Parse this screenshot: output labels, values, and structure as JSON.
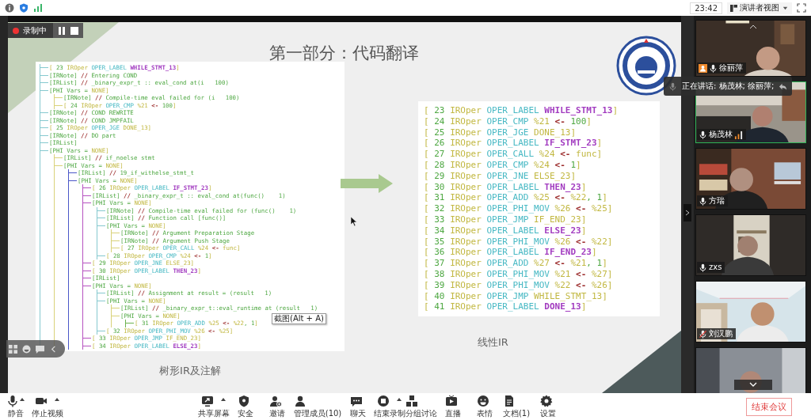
{
  "top_bar": {
    "time": "23:42",
    "view_button": {
      "label": "演讲者视图"
    }
  },
  "recording": {
    "label": "录制中"
  },
  "slide": {
    "title": "第一部分：代码翻译",
    "tree_panel": {
      "caption": "树形IR及注解",
      "lines": [
        {
          "tokens": [
            {
              "kind": "type",
              "text": "[ "
            },
            {
              "kind": "text",
              "text": "23 "
            },
            {
              "kind": "type",
              "text": "IROper "
            },
            {
              "kind": "opcode",
              "text": "OPER_LABEL "
            },
            {
              "kind": "label",
              "text": "WHILE_STMT_13"
            },
            {
              "kind": "type",
              "text": "]"
            }
          ]
        },
        {
          "tokens": [
            {
              "kind": "text",
              "text": "[IRNote] "
            },
            {
              "kind": "symbol",
              "text": "//"
            },
            {
              "kind": "text",
              "text": " Entering COND"
            }
          ]
        },
        {
          "tokens": [
            {
              "kind": "text",
              "text": "[IRList] "
            },
            {
              "kind": "symbol",
              "text": "//"
            },
            {
              "kind": "text",
              "text": " _binary_expr_t :: eval_cond at(i   100)"
            }
          ]
        },
        {
          "tokens": [
            {
              "kind": "text",
              "text": "[PHI Vars = "
            },
            {
              "kind": "type",
              "text": "NONE]"
            }
          ],
          "children": [
            {
              "tokens": [
                {
                  "kind": "text",
                  "text": "[IRNote] "
                },
                {
                  "kind": "symbol",
                  "text": "//"
                },
                {
                  "kind": "text",
                  "text": " Compile-time eval failed for (i   100)"
                }
              ]
            },
            {
              "tokens": [
                {
                  "kind": "type",
                  "text": "[ "
                },
                {
                  "kind": "text",
                  "text": "24 "
                },
                {
                  "kind": "type",
                  "text": "IROper "
                },
                {
                  "kind": "opcode",
                  "text": "OPER_CMP "
                },
                {
                  "kind": "type",
                  "text": "%21 "
                },
                {
                  "kind": "symbol",
                  "text": "<-"
                },
                {
                  "kind": "text",
                  "text": " 100"
                },
                {
                  "kind": "type",
                  "text": "]"
                }
              ]
            }
          ]
        },
        {
          "tokens": [
            {
              "kind": "text",
              "text": "[IRNote] "
            },
            {
              "kind": "symbol",
              "text": "//"
            },
            {
              "kind": "text",
              "text": " COND REWRITE"
            }
          ]
        },
        {
          "tokens": [
            {
              "kind": "text",
              "text": "[IRNote] "
            },
            {
              "kind": "symbol",
              "text": "//"
            },
            {
              "kind": "text",
              "text": " COND JMPFAIL"
            }
          ]
        },
        {
          "tokens": [
            {
              "kind": "type",
              "text": "[ "
            },
            {
              "kind": "text",
              "text": "25 "
            },
            {
              "kind": "type",
              "text": "IROper "
            },
            {
              "kind": "opcode",
              "text": "OPER_JGE "
            },
            {
              "kind": "type",
              "text": "DONE_13]"
            }
          ]
        },
        {
          "tokens": [
            {
              "kind": "text",
              "text": "[IRNote] "
            },
            {
              "kind": "symbol",
              "text": "//"
            },
            {
              "kind": "text",
              "text": " DO part"
            }
          ]
        },
        {
          "tokens": [
            {
              "kind": "text",
              "text": "[IRList]"
            }
          ]
        },
        {
          "tokens": [
            {
              "kind": "text",
              "text": "[PHI Vars = "
            },
            {
              "kind": "type",
              "text": "NONE]"
            }
          ],
          "children": [
            {
              "tokens": [
                {
                  "kind": "text",
                  "text": "[IRList] "
                },
                {
                  "kind": "symbol",
                  "text": "//"
                },
                {
                  "kind": "text",
                  "text": " if_noelse stmt"
                }
              ]
            },
            {
              "tokens": [
                {
                  "kind": "text",
                  "text": "[PHI Vars = "
                },
                {
                  "kind": "type",
                  "text": "NONE]"
                }
              ],
              "children": [
                {
                  "tokens": [
                    {
                      "kind": "text",
                      "text": "[IRList] "
                    },
                    {
                      "kind": "symbol",
                      "text": "//"
                    },
                    {
                      "kind": "text",
                      "text": " 19_if_withelse_stmt_t"
                    }
                  ]
                },
                {
                  "tokens": [
                    {
                      "kind": "text",
                      "text": "[PHI Vars = "
                    },
                    {
                      "kind": "type",
                      "text": "NONE]"
                    }
                  ],
                  "children": [
                    {
                      "tokens": [
                        {
                          "kind": "type",
                          "text": "[ "
                        },
                        {
                          "kind": "text",
                          "text": "26 "
                        },
                        {
                          "kind": "type",
                          "text": "IROper "
                        },
                        {
                          "kind": "opcode",
                          "text": "OPER_LABEL "
                        },
                        {
                          "kind": "label",
                          "text": "IF_STMT_23"
                        },
                        {
                          "kind": "type",
                          "text": "]"
                        }
                      ]
                    },
                    {
                      "tokens": [
                        {
                          "kind": "text",
                          "text": "[IRList] "
                        },
                        {
                          "kind": "symbol",
                          "text": "//"
                        },
                        {
                          "kind": "text",
                          "text": " _binary_expr_t :: eval_cond at(func()    1)"
                        }
                      ]
                    },
                    {
                      "tokens": [
                        {
                          "kind": "text",
                          "text": "[PHI Vars = "
                        },
                        {
                          "kind": "type",
                          "text": "NONE]"
                        }
                      ],
                      "children": [
                        {
                          "tokens": [
                            {
                              "kind": "text",
                              "text": "[IRNote] "
                            },
                            {
                              "kind": "symbol",
                              "text": "//"
                            },
                            {
                              "kind": "text",
                              "text": " Compile-time eval failed for (func()    1)"
                            }
                          ]
                        },
                        {
                          "tokens": [
                            {
                              "kind": "text",
                              "text": "[IRList] "
                            },
                            {
                              "kind": "symbol",
                              "text": "//"
                            },
                            {
                              "kind": "text",
                              "text": " Function call [func()]"
                            }
                          ]
                        },
                        {
                          "tokens": [
                            {
                              "kind": "text",
                              "text": "[PHI Vars = "
                            },
                            {
                              "kind": "type",
                              "text": "NONE]"
                            }
                          ],
                          "children": [
                            {
                              "tokens": [
                                {
                                  "kind": "text",
                                  "text": "[IRNote] "
                                },
                                {
                                  "kind": "symbol",
                                  "text": "//"
                                },
                                {
                                  "kind": "text",
                                  "text": " Argument Preparation Stage"
                                }
                              ]
                            },
                            {
                              "tokens": [
                                {
                                  "kind": "text",
                                  "text": "[IRNote] "
                                },
                                {
                                  "kind": "symbol",
                                  "text": "//"
                                },
                                {
                                  "kind": "text",
                                  "text": " Argument Push Stage"
                                }
                              ]
                            },
                            {
                              "tokens": [
                                {
                                  "kind": "type",
                                  "text": "[ "
                                },
                                {
                                  "kind": "text",
                                  "text": "27 "
                                },
                                {
                                  "kind": "type",
                                  "text": "IROper "
                                },
                                {
                                  "kind": "opcode",
                                  "text": "OPER_CALL "
                                },
                                {
                                  "kind": "type",
                                  "text": "%24 "
                                },
                                {
                                  "kind": "symbol",
                                  "text": "<-"
                                },
                                {
                                  "kind": "type",
                                  "text": " func]"
                                }
                              ]
                            }
                          ]
                        },
                        {
                          "tokens": [
                            {
                              "kind": "type",
                              "text": "[ "
                            },
                            {
                              "kind": "text",
                              "text": "28 "
                            },
                            {
                              "kind": "type",
                              "text": "IROper "
                            },
                            {
                              "kind": "opcode",
                              "text": "OPER_CMP "
                            },
                            {
                              "kind": "type",
                              "text": "%24 "
                            },
                            {
                              "kind": "symbol",
                              "text": "<-"
                            },
                            {
                              "kind": "text",
                              "text": " 1"
                            },
                            {
                              "kind": "type",
                              "text": "]"
                            }
                          ]
                        }
                      ]
                    },
                    {
                      "tokens": [
                        {
                          "kind": "type",
                          "text": "[ "
                        },
                        {
                          "kind": "text",
                          "text": "29 "
                        },
                        {
                          "kind": "type",
                          "text": "IROper "
                        },
                        {
                          "kind": "opcode",
                          "text": "OPER_JNE "
                        },
                        {
                          "kind": "type",
                          "text": "ELSE_23]"
                        }
                      ]
                    },
                    {
                      "tokens": [
                        {
                          "kind": "type",
                          "text": "[ "
                        },
                        {
                          "kind": "text",
                          "text": "30 "
                        },
                        {
                          "kind": "type",
                          "text": "IROper "
                        },
                        {
                          "kind": "opcode",
                          "text": "OPER_LABEL "
                        },
                        {
                          "kind": "label",
                          "text": "THEN_23"
                        },
                        {
                          "kind": "type",
                          "text": "]"
                        }
                      ]
                    },
                    {
                      "tokens": [
                        {
                          "kind": "text",
                          "text": "[IRList]"
                        }
                      ]
                    },
                    {
                      "tokens": [
                        {
                          "kind": "text",
                          "text": "[PHI Vars = "
                        },
                        {
                          "kind": "type",
                          "text": "NONE]"
                        }
                      ],
                      "children": [
                        {
                          "tokens": [
                            {
                              "kind": "text",
                              "text": "[IRList] "
                            },
                            {
                              "kind": "symbol",
                              "text": "//"
                            },
                            {
                              "kind": "text",
                              "text": " Assignment at result = (result   1)"
                            }
                          ]
                        },
                        {
                          "tokens": [
                            {
                              "kind": "text",
                              "text": "[PHI Vars = "
                            },
                            {
                              "kind": "type",
                              "text": "NONE]"
                            }
                          ],
                          "children": [
                            {
                              "tokens": [
                                {
                                  "kind": "text",
                                  "text": "[IRList] "
                                },
                                {
                                  "kind": "symbol",
                                  "text": "//"
                                },
                                {
                                  "kind": "text",
                                  "text": " _binary_expr_t::eval_runtime at (result   1)"
                                }
                              ]
                            },
                            {
                              "tokens": [
                                {
                                  "kind": "text",
                                  "text": "[PHI Vars = "
                                },
                                {
                                  "kind": "type",
                                  "text": "NONE]"
                                }
                              ],
                              "children": [
                                {
                                  "tokens": [
                                    {
                                      "kind": "type",
                                      "text": "[ "
                                    },
                                    {
                                      "kind": "text",
                                      "text": "31 "
                                    },
                                    {
                                      "kind": "type",
                                      "text": "IROper "
                                    },
                                    {
                                      "kind": "opcode",
                                      "text": "OPER_ADD "
                                    },
                                    {
                                      "kind": "type",
                                      "text": "%25 "
                                    },
                                    {
                                      "kind": "symbol",
                                      "text": "<-"
                                    },
                                    {
                                      "kind": "type",
                                      "text": " %22"
                                    },
                                    {
                                      "kind": "text",
                                      "text": ", 1"
                                    },
                                    {
                                      "kind": "type",
                                      "text": "]"
                                    }
                                  ]
                                }
                              ]
                            }
                          ]
                        },
                        {
                          "tokens": [
                            {
                              "kind": "type",
                              "text": "[ "
                            },
                            {
                              "kind": "text",
                              "text": "32 "
                            },
                            {
                              "kind": "type",
                              "text": "IROper "
                            },
                            {
                              "kind": "opcode",
                              "text": "OPER_PHI_MOV "
                            },
                            {
                              "kind": "type",
                              "text": "%26 "
                            },
                            {
                              "kind": "symbol",
                              "text": "<-"
                            },
                            {
                              "kind": "type",
                              "text": " %25]"
                            }
                          ]
                        }
                      ]
                    },
                    {
                      "tokens": [
                        {
                          "kind": "type",
                          "text": "[ "
                        },
                        {
                          "kind": "text",
                          "text": "33 "
                        },
                        {
                          "kind": "type",
                          "text": "IROper "
                        },
                        {
                          "kind": "opcode",
                          "text": "OPER_JMP "
                        },
                        {
                          "kind": "type",
                          "text": "IF_END_23]"
                        }
                      ]
                    },
                    {
                      "tokens": [
                        {
                          "kind": "type",
                          "text": "[ "
                        },
                        {
                          "kind": "text",
                          "text": "34 "
                        },
                        {
                          "kind": "type",
                          "text": "IROper "
                        },
                        {
                          "kind": "opcode",
                          "text": "OPER_LABEL "
                        },
                        {
                          "kind": "label",
                          "text": "ELSE_23"
                        },
                        {
                          "kind": "type",
                          "text": "]"
                        }
                      ]
                    }
                  ]
                }
              ]
            }
          ]
        }
      ]
    },
    "linear_panel": {
      "caption": "线性IR",
      "lines": [
        {
          "tokens": [
            {
              "kind": "type",
              "text": "[ "
            },
            {
              "kind": "text",
              "text": "23 "
            },
            {
              "kind": "type",
              "text": "IROper "
            },
            {
              "kind": "opcode",
              "text": "OPER_LABEL "
            },
            {
              "kind": "label",
              "text": "WHILE_STMT_13"
            },
            {
              "kind": "type",
              "text": "]"
            }
          ]
        },
        {
          "tokens": [
            {
              "kind": "type",
              "text": "[ "
            },
            {
              "kind": "text",
              "text": "24 "
            },
            {
              "kind": "type",
              "text": "IROper "
            },
            {
              "kind": "opcode",
              "text": "OPER_CMP "
            },
            {
              "kind": "type",
              "text": "%21 "
            },
            {
              "kind": "symbol",
              "text": "<-"
            },
            {
              "kind": "text",
              "text": " 100"
            },
            {
              "kind": "type",
              "text": "]"
            }
          ]
        },
        {
          "tokens": [
            {
              "kind": "type",
              "text": "[ "
            },
            {
              "kind": "text",
              "text": "25 "
            },
            {
              "kind": "type",
              "text": "IROper "
            },
            {
              "kind": "opcode",
              "text": "OPER_JGE "
            },
            {
              "kind": "type",
              "text": "DONE_13]"
            }
          ]
        },
        {
          "tokens": [
            {
              "kind": "type",
              "text": "[ "
            },
            {
              "kind": "text",
              "text": "26 "
            },
            {
              "kind": "type",
              "text": "IROper "
            },
            {
              "kind": "opcode",
              "text": "OPER_LABEL "
            },
            {
              "kind": "label",
              "text": "IF_STMT_23"
            },
            {
              "kind": "type",
              "text": "]"
            }
          ]
        },
        {
          "tokens": [
            {
              "kind": "type",
              "text": "[ "
            },
            {
              "kind": "text",
              "text": "27 "
            },
            {
              "kind": "type",
              "text": "IROper "
            },
            {
              "kind": "opcode",
              "text": "OPER_CALL "
            },
            {
              "kind": "type",
              "text": "%24 "
            },
            {
              "kind": "symbol",
              "text": "<-"
            },
            {
              "kind": "type",
              "text": " func]"
            }
          ]
        },
        {
          "tokens": [
            {
              "kind": "type",
              "text": "[ "
            },
            {
              "kind": "text",
              "text": "28 "
            },
            {
              "kind": "type",
              "text": "IROper "
            },
            {
              "kind": "opcode",
              "text": "OPER_CMP "
            },
            {
              "kind": "type",
              "text": "%24 "
            },
            {
              "kind": "symbol",
              "text": "<-"
            },
            {
              "kind": "text",
              "text": " 1"
            },
            {
              "kind": "type",
              "text": "]"
            }
          ]
        },
        {
          "tokens": [
            {
              "kind": "type",
              "text": "[ "
            },
            {
              "kind": "text",
              "text": "29 "
            },
            {
              "kind": "type",
              "text": "IROper "
            },
            {
              "kind": "opcode",
              "text": "OPER_JNE "
            },
            {
              "kind": "type",
              "text": "ELSE_23]"
            }
          ]
        },
        {
          "tokens": [
            {
              "kind": "type",
              "text": "[ "
            },
            {
              "kind": "text",
              "text": "30 "
            },
            {
              "kind": "type",
              "text": "IROper "
            },
            {
              "kind": "opcode",
              "text": "OPER_LABEL "
            },
            {
              "kind": "label",
              "text": "THEN_23"
            },
            {
              "kind": "type",
              "text": "]"
            }
          ]
        },
        {
          "tokens": [
            {
              "kind": "type",
              "text": "[ "
            },
            {
              "kind": "text",
              "text": "31 "
            },
            {
              "kind": "type",
              "text": "IROper "
            },
            {
              "kind": "opcode",
              "text": "OPER_ADD "
            },
            {
              "kind": "type",
              "text": "%25 "
            },
            {
              "kind": "symbol",
              "text": "<-"
            },
            {
              "kind": "type",
              "text": " %22"
            },
            {
              "kind": "text",
              "text": ", 1"
            },
            {
              "kind": "type",
              "text": "]"
            }
          ]
        },
        {
          "tokens": [
            {
              "kind": "type",
              "text": "[ "
            },
            {
              "kind": "text",
              "text": "32 "
            },
            {
              "kind": "type",
              "text": "IROper "
            },
            {
              "kind": "opcode",
              "text": "OPER_PHI_MOV "
            },
            {
              "kind": "type",
              "text": "%26 "
            },
            {
              "kind": "symbol",
              "text": "<-"
            },
            {
              "kind": "type",
              "text": " %25]"
            }
          ]
        },
        {
          "tokens": [
            {
              "kind": "type",
              "text": "[ "
            },
            {
              "kind": "text",
              "text": "33 "
            },
            {
              "kind": "type",
              "text": "IROper "
            },
            {
              "kind": "opcode",
              "text": "OPER_JMP "
            },
            {
              "kind": "type",
              "text": "IF_END_23]"
            }
          ]
        },
        {
          "tokens": [
            {
              "kind": "type",
              "text": "[ "
            },
            {
              "kind": "text",
              "text": "34 "
            },
            {
              "kind": "type",
              "text": "IROper "
            },
            {
              "kind": "opcode",
              "text": "OPER_LABEL "
            },
            {
              "kind": "label",
              "text": "ELSE_23"
            },
            {
              "kind": "type",
              "text": "]"
            }
          ]
        },
        {
          "tokens": [
            {
              "kind": "type",
              "text": "[ "
            },
            {
              "kind": "text",
              "text": "35 "
            },
            {
              "kind": "type",
              "text": "IROper "
            },
            {
              "kind": "opcode",
              "text": "OPER_PHI_MOV "
            },
            {
              "kind": "type",
              "text": "%26 "
            },
            {
              "kind": "symbol",
              "text": "<-"
            },
            {
              "kind": "type",
              "text": " %22]"
            }
          ]
        },
        {
          "tokens": [
            {
              "kind": "type",
              "text": "[ "
            },
            {
              "kind": "text",
              "text": "36 "
            },
            {
              "kind": "type",
              "text": "IROper "
            },
            {
              "kind": "opcode",
              "text": "OPER_LABEL "
            },
            {
              "kind": "label",
              "text": "IF_END_23"
            },
            {
              "kind": "type",
              "text": "]"
            }
          ]
        },
        {
          "tokens": [
            {
              "kind": "type",
              "text": "[ "
            },
            {
              "kind": "text",
              "text": "37 "
            },
            {
              "kind": "type",
              "text": "IROper "
            },
            {
              "kind": "opcode",
              "text": "OPER_ADD "
            },
            {
              "kind": "type",
              "text": "%27 "
            },
            {
              "kind": "symbol",
              "text": "<-"
            },
            {
              "kind": "type",
              "text": " %21"
            },
            {
              "kind": "text",
              "text": ", 1"
            },
            {
              "kind": "type",
              "text": "]"
            }
          ]
        },
        {
          "tokens": [
            {
              "kind": "type",
              "text": "[ "
            },
            {
              "kind": "text",
              "text": "38 "
            },
            {
              "kind": "type",
              "text": "IROper "
            },
            {
              "kind": "opcode",
              "text": "OPER_PHI_MOV "
            },
            {
              "kind": "type",
              "text": "%21 "
            },
            {
              "kind": "symbol",
              "text": "<-"
            },
            {
              "kind": "type",
              "text": " %27]"
            }
          ]
        },
        {
          "tokens": [
            {
              "kind": "type",
              "text": "[ "
            },
            {
              "kind": "text",
              "text": "39 "
            },
            {
              "kind": "type",
              "text": "IROper "
            },
            {
              "kind": "opcode",
              "text": "OPER_PHI_MOV "
            },
            {
              "kind": "type",
              "text": "%22 "
            },
            {
              "kind": "symbol",
              "text": "<-"
            },
            {
              "kind": "type",
              "text": " %26]"
            }
          ]
        },
        {
          "tokens": [
            {
              "kind": "type",
              "text": "[ "
            },
            {
              "kind": "text",
              "text": "40 "
            },
            {
              "kind": "type",
              "text": "IROper "
            },
            {
              "kind": "opcode",
              "text": "OPER_JMP "
            },
            {
              "kind": "type",
              "text": "WHILE_STMT_13]"
            }
          ]
        },
        {
          "tokens": [
            {
              "kind": "type",
              "text": "[ "
            },
            {
              "kind": "text",
              "text": "41 "
            },
            {
              "kind": "type",
              "text": "IROper "
            },
            {
              "kind": "opcode",
              "text": "OPER_LABEL "
            },
            {
              "kind": "label",
              "text": "DONE_13"
            },
            {
              "kind": "type",
              "text": "]"
            }
          ]
        }
      ]
    }
  },
  "tooltip": "截图(Alt + A)",
  "speaking_banner": "正在讲话: 杨茂林; 徐丽萍;",
  "video_tiles": [
    {
      "name": "徐丽萍",
      "host": true,
      "speaking": false,
      "muted": false
    },
    {
      "name": "杨茂林",
      "host": false,
      "speaking": true,
      "muted": false
    },
    {
      "name": "方瑞",
      "host": false,
      "speaking": false,
      "muted": false
    },
    {
      "name": "zxs",
      "host": false,
      "speaking": false,
      "muted": false
    },
    {
      "name": "刘汉鹏",
      "host": false,
      "speaking": false,
      "muted": true
    },
    {
      "speaking": false
    }
  ],
  "toolbar": {
    "buttons": [
      {
        "kind": "mic",
        "label": "静音",
        "has_menu": true
      },
      {
        "kind": "video",
        "label": "停止视频",
        "has_menu": true
      },
      {
        "kind": "share",
        "label": "共享屏幕",
        "has_menu": true
      },
      {
        "kind": "security",
        "label": "安全",
        "has_menu": false
      },
      {
        "kind": "invite",
        "label": "邀请",
        "has_menu": false
      },
      {
        "kind": "participants",
        "label": "管理成员(10)",
        "has_menu": false
      },
      {
        "kind": "chat",
        "label": "聊天",
        "has_menu": false
      },
      {
        "kind": "record",
        "label": "结束录制",
        "has_menu": true
      },
      {
        "kind": "breakout",
        "label": "分组讨论",
        "has_menu": false
      },
      {
        "kind": "live",
        "label": "直播",
        "has_menu": false
      },
      {
        "kind": "emoji",
        "label": "表情",
        "has_menu": false
      },
      {
        "kind": "document",
        "label": "文档(1)",
        "has_menu": false
      },
      {
        "kind": "settings",
        "label": "设置",
        "has_menu": false
      }
    ],
    "end_button": "结束会议"
  }
}
